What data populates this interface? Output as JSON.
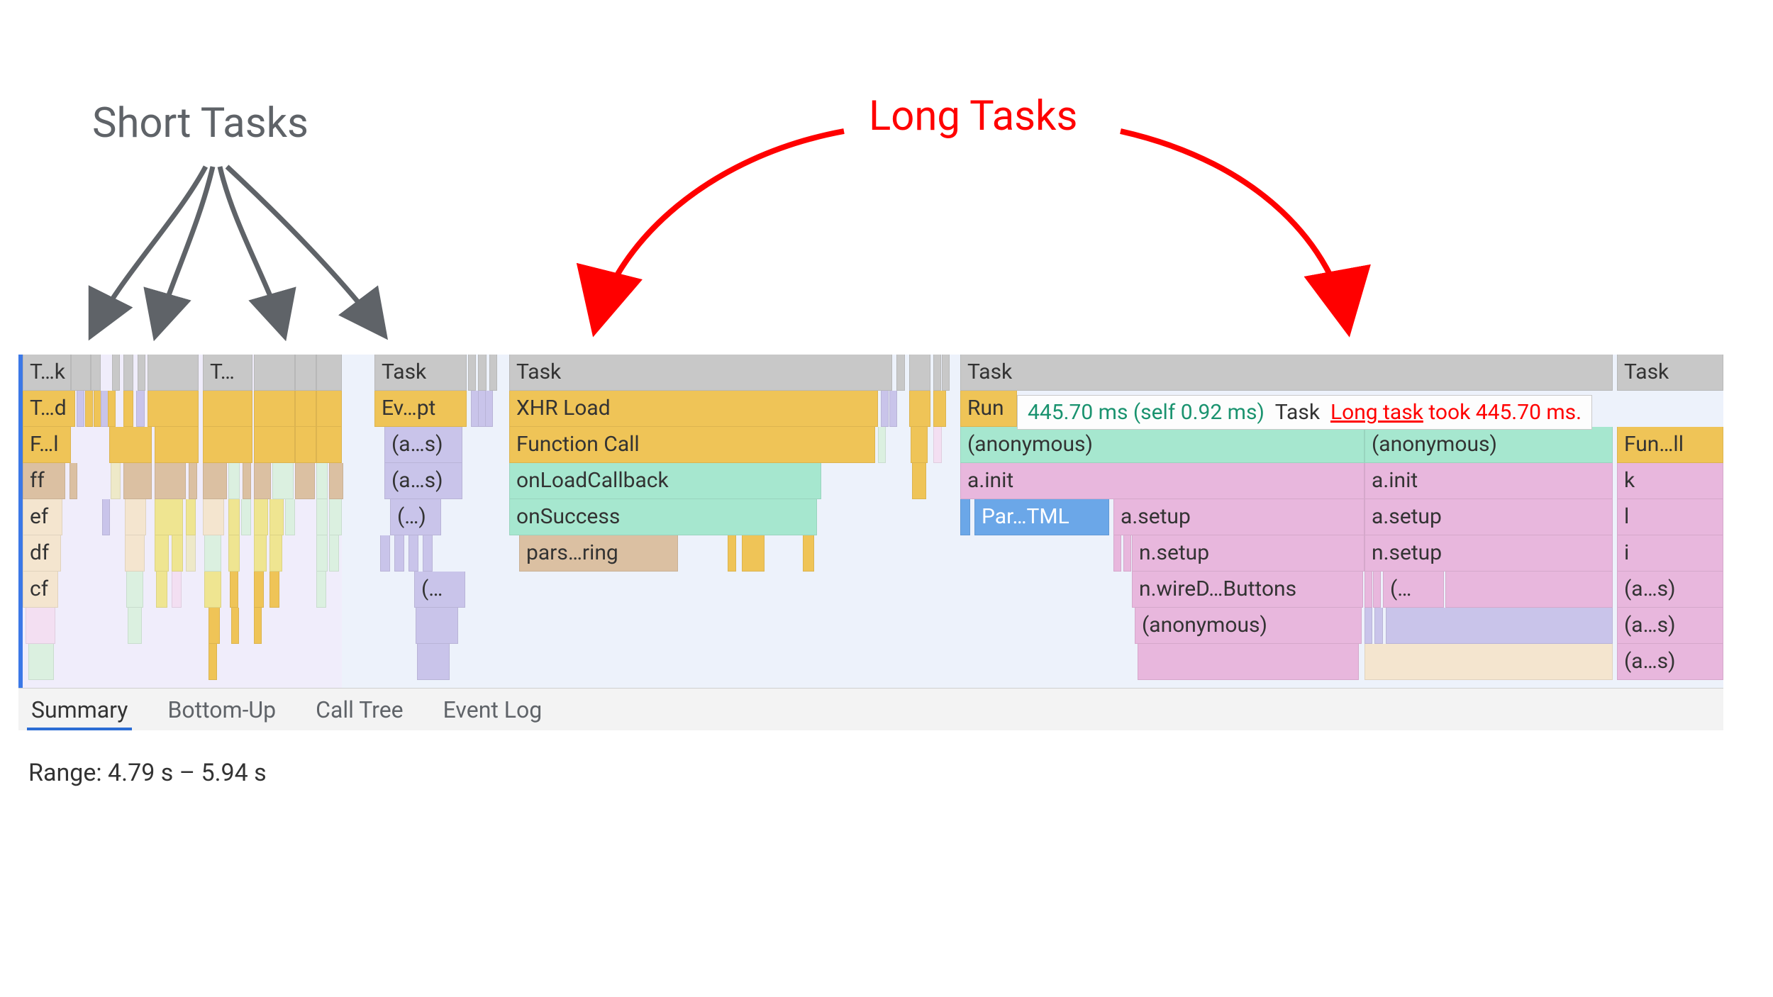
{
  "annotations": {
    "short_tasks": "Short Tasks",
    "long_tasks": "Long Tasks"
  },
  "tooltip": {
    "time": "445.70 ms (self 0.92 ms)",
    "task_label": "Task",
    "warn_prefix": "Long task",
    "warn_suffix": " took 445.70 ms."
  },
  "tabs": {
    "summary": "Summary",
    "bottom_up": "Bottom-Up",
    "call_tree": "Call Tree",
    "event_log": "Event Log"
  },
  "range_label": "Range:  4.79 s – 5.94 s",
  "flame": {
    "tasks": {
      "c1a": "T…k",
      "c1b": "T…",
      "c2": "Task",
      "c3": "Task",
      "c4": "Task",
      "c5": "Task"
    },
    "row2": {
      "c1": "T…d",
      "c2": "Ev…pt",
      "c3": "XHR Load",
      "c4": "Run"
    },
    "row3": {
      "c1": "F…l",
      "c2": "(a…s)",
      "c3": "Function Call",
      "c4a": "(anonymous)",
      "c4b": "(anonymous)",
      "c5": "Fun…ll"
    },
    "row4": {
      "c1": "ff",
      "c2": "(a…s)",
      "c3": "onLoadCallback",
      "c4a": "a.init",
      "c4b": "a.init",
      "c5": "k"
    },
    "row5": {
      "c1": "ef",
      "c2": "(…)",
      "c3": "onSuccess",
      "parse": "Par…TML",
      "c4a": "a.setup",
      "c4b": "a.setup",
      "c5": "l"
    },
    "row6": {
      "c1": "df",
      "c3": "pars…ring",
      "c4a": "n.setup",
      "c4b": "n.setup",
      "c5": "i"
    },
    "row7": {
      "c1": "cf",
      "c2": "(…",
      "c4a": "n.wireD…Buttons",
      "c4b": "(…",
      "c5": "(a…s)"
    },
    "row8": {
      "c4a": "(anonymous)",
      "c5": "(a…s)"
    },
    "row9": {
      "c5": "(a…s)"
    }
  }
}
